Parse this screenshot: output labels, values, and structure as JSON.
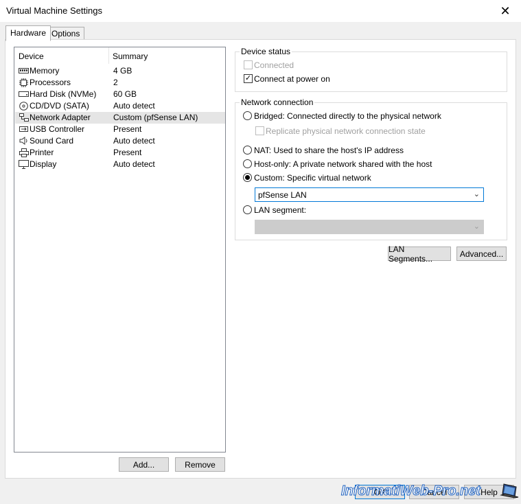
{
  "window": {
    "title": "Virtual Machine Settings",
    "close_label": "✕"
  },
  "tabs": [
    {
      "label": "Hardware"
    },
    {
      "label": "Options"
    }
  ],
  "device_list": {
    "headers": {
      "device": "Device",
      "summary": "Summary"
    },
    "rows": [
      {
        "icon": "memory-icon",
        "name": "Memory",
        "summary": "4 GB"
      },
      {
        "icon": "processor-icon",
        "name": "Processors",
        "summary": "2"
      },
      {
        "icon": "hard-disk-icon",
        "name": "Hard Disk (NVMe)",
        "summary": "60 GB"
      },
      {
        "icon": "cd-dvd-icon",
        "name": "CD/DVD (SATA)",
        "summary": "Auto detect"
      },
      {
        "icon": "network-adapter-icon",
        "name": "Network Adapter",
        "summary": "Custom (pfSense LAN)"
      },
      {
        "icon": "usb-icon",
        "name": "USB Controller",
        "summary": "Present"
      },
      {
        "icon": "sound-card-icon",
        "name": "Sound Card",
        "summary": "Auto detect"
      },
      {
        "icon": "printer-icon",
        "name": "Printer",
        "summary": "Present"
      },
      {
        "icon": "display-icon",
        "name": "Display",
        "summary": "Auto detect"
      }
    ],
    "selected_index": 4
  },
  "device_status": {
    "legend": "Device status",
    "connected_label": "Connected",
    "connected_checked": false,
    "power_on_label": "Connect at power on",
    "power_on_checked": true
  },
  "network_connection": {
    "legend": "Network connection",
    "bridged_label": "Bridged: Connected directly to the physical network",
    "replicate_label": "Replicate physical network connection state",
    "nat_label": "NAT: Used to share the host's IP address",
    "host_only_label": "Host-only: A private network shared with the host",
    "custom_label": "Custom: Specific virtual network",
    "custom_selected": "pfSense LAN",
    "lan_segment_label": "LAN segment:",
    "lan_segment_selected": ""
  },
  "buttons": {
    "lan_segments": "LAN Segments...",
    "advanced": "Advanced...",
    "add": "Add...",
    "remove": "Remove",
    "ok": "OK",
    "cancel": "Cancel",
    "help": "Help"
  },
  "watermark": "InformatiWeb-Pro.net",
  "colors": {
    "accent": "#0078d7",
    "selected_row": "#e5e5e5"
  }
}
